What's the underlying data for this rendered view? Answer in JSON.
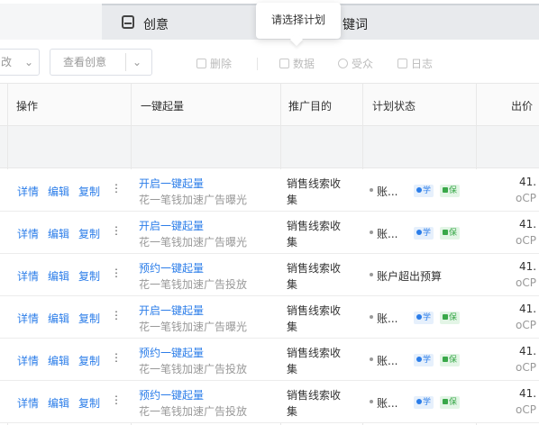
{
  "tabs": {
    "creative_label": "创意",
    "keyword_label_partial": "键词"
  },
  "tooltip": {
    "text": "请选择计划"
  },
  "toolbar": {
    "left_dropdown_label": "改",
    "view_creative_label": "查看创意",
    "delete_label": "删除",
    "data_label": "数据",
    "audience_label": "受众",
    "log_label": "日志"
  },
  "table": {
    "headers": {
      "operation": "操作",
      "one_key": "一键起量",
      "purpose": "推广目的",
      "status": "计划状态",
      "bid": "出价"
    },
    "ops": {
      "detail": "详情",
      "edit": "编辑",
      "copy": "复制",
      "more": "⋮"
    },
    "badges": {
      "xue": "学",
      "bao": "保"
    },
    "rows": [
      {
        "onekey": "开启一键起量",
        "onekey_sub": "花一笔钱加速广告曝光",
        "purpose1": "销售线索收",
        "purpose2": "集",
        "status": "账...",
        "show_badges": true,
        "bid": "41.",
        "bid_sub": "oCP"
      },
      {
        "onekey": "开启一键起量",
        "onekey_sub": "花一笔钱加速广告曝光",
        "purpose1": "销售线索收",
        "purpose2": "集",
        "status": "账...",
        "show_badges": true,
        "bid": "41.",
        "bid_sub": "oCP"
      },
      {
        "onekey": "预约一键起量",
        "onekey_sub": "花一笔钱加速广告投放",
        "purpose1": "销售线索收",
        "purpose2": "集",
        "status": "账户超出预算",
        "show_badges": false,
        "bid": "41.",
        "bid_sub": "oCP"
      },
      {
        "onekey": "开启一键起量",
        "onekey_sub": "花一笔钱加速广告曝光",
        "purpose1": "销售线索收",
        "purpose2": "集",
        "status": "账...",
        "show_badges": true,
        "bid": "41.",
        "bid_sub": "oCP"
      },
      {
        "onekey": "预约一键起量",
        "onekey_sub": "花一笔钱加速广告投放",
        "purpose1": "销售线索收",
        "purpose2": "集",
        "status": "账...",
        "show_badges": true,
        "bid": "41.",
        "bid_sub": "oCP"
      },
      {
        "onekey": "预约一键起量",
        "onekey_sub": "花一笔钱加速广告投放",
        "purpose1": "销售线索收",
        "purpose2": "集",
        "status": "账...",
        "show_badges": true,
        "bid": "41.",
        "bid_sub": "oCP"
      }
    ]
  }
}
